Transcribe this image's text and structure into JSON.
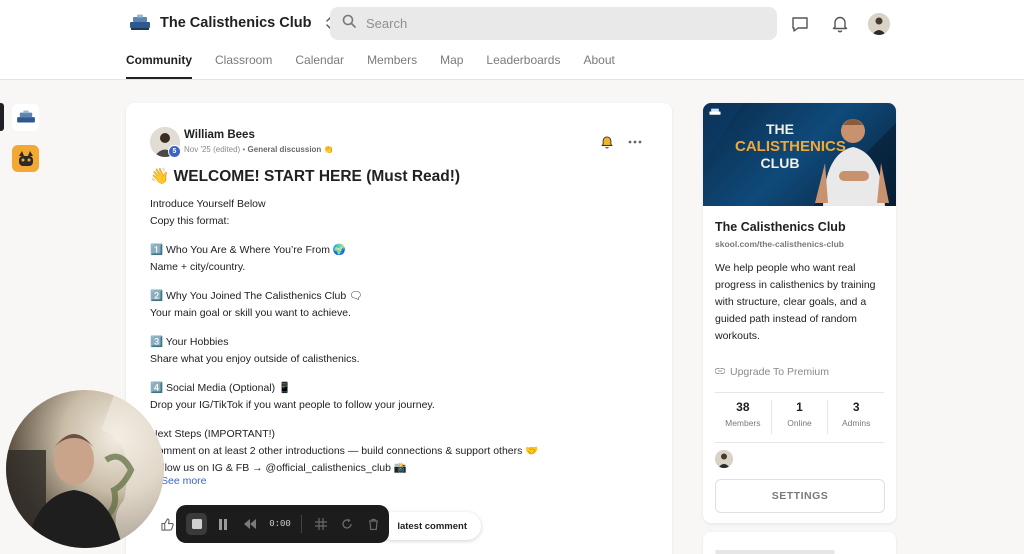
{
  "header": {
    "community_name": "The Calisthenics Club",
    "search_placeholder": "Search"
  },
  "tabs": [
    {
      "label": "Community",
      "active": true
    },
    {
      "label": "Classroom",
      "active": false
    },
    {
      "label": "Calendar",
      "active": false
    },
    {
      "label": "Members",
      "active": false
    },
    {
      "label": "Map",
      "active": false
    },
    {
      "label": "Leaderboards",
      "active": false
    },
    {
      "label": "About",
      "active": false
    }
  ],
  "post": {
    "author": "William Bees",
    "level": "5",
    "date": "Nov '25 (edited)",
    "separator": "•",
    "category": "General discussion 👏",
    "title": "👋 WELCOME! START HERE (Must Read!)",
    "intro_line1": "Introduce Yourself Below",
    "intro_line2": "Copy this format:",
    "item1_title": "1️⃣ Who You Are & Where You’re From 🌍",
    "item1_body": "Name + city/country.",
    "item2_title": "2️⃣ Why You Joined The Calisthenics Club 🗨",
    "item2_body": "Your main goal or skill you want to achieve.",
    "item3_title": "3️⃣ Your Hobbies",
    "item3_body": "Share what you enjoy outside of calisthenics.",
    "item4_title": "4️⃣ Social Media (Optional) 📱",
    "item4_body": "Drop your IG/TikTok if you want people to follow your journey.",
    "next_title": "Next Steps (IMPORTANT!)",
    "next_line1": "Comment on at least 2 other introductions — build connections & support others 🤝",
    "next_line2": "Follow us on IG & FB → @official_calisthenics_club 📸",
    "see_more": "See more",
    "latest_comment": "latest comment"
  },
  "sidebar": {
    "banner_line1": "THE",
    "banner_line2": "CALISTHENICS",
    "banner_line3": "CLUB",
    "title": "The Calisthenics Club",
    "url": "skool.com/the-calisthenics-club",
    "description": "We help people who want real progress in calisthenics by training with structure, clear goals, and a guided path instead of random workouts.",
    "upgrade": "Upgrade To Premium",
    "stats": [
      {
        "value": "38",
        "label": "Members"
      },
      {
        "value": "1",
        "label": "Online"
      },
      {
        "value": "3",
        "label": "Admins"
      }
    ],
    "settings_label": "SETTINGS"
  },
  "recorder": {
    "time": "0:00"
  },
  "colors": {
    "accent_blue": "#3b64c8",
    "banner_gold": "#f2a833",
    "banner_navy": "#0a2a4a"
  }
}
